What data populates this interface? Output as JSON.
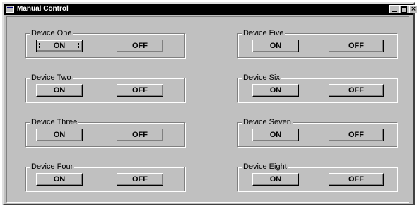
{
  "window": {
    "title": "Manual Control",
    "controls": {
      "minimize": "",
      "maximize": "",
      "close": "×"
    }
  },
  "devices": [
    {
      "name": "Device One",
      "on_label": "ON",
      "off_label": "OFF",
      "focused": "on"
    },
    {
      "name": "Device Two",
      "on_label": "ON",
      "off_label": "OFF"
    },
    {
      "name": "Device Three",
      "on_label": "ON",
      "off_label": "OFF"
    },
    {
      "name": "Device Four",
      "on_label": "ON",
      "off_label": "OFF"
    },
    {
      "name": "Device Five",
      "on_label": "ON",
      "off_label": "OFF"
    },
    {
      "name": "Device Six",
      "on_label": "ON",
      "off_label": "OFF"
    },
    {
      "name": "Device Seven",
      "on_label": "ON",
      "off_label": "OFF"
    },
    {
      "name": "Device Eight",
      "on_label": "ON",
      "off_label": "OFF"
    }
  ]
}
